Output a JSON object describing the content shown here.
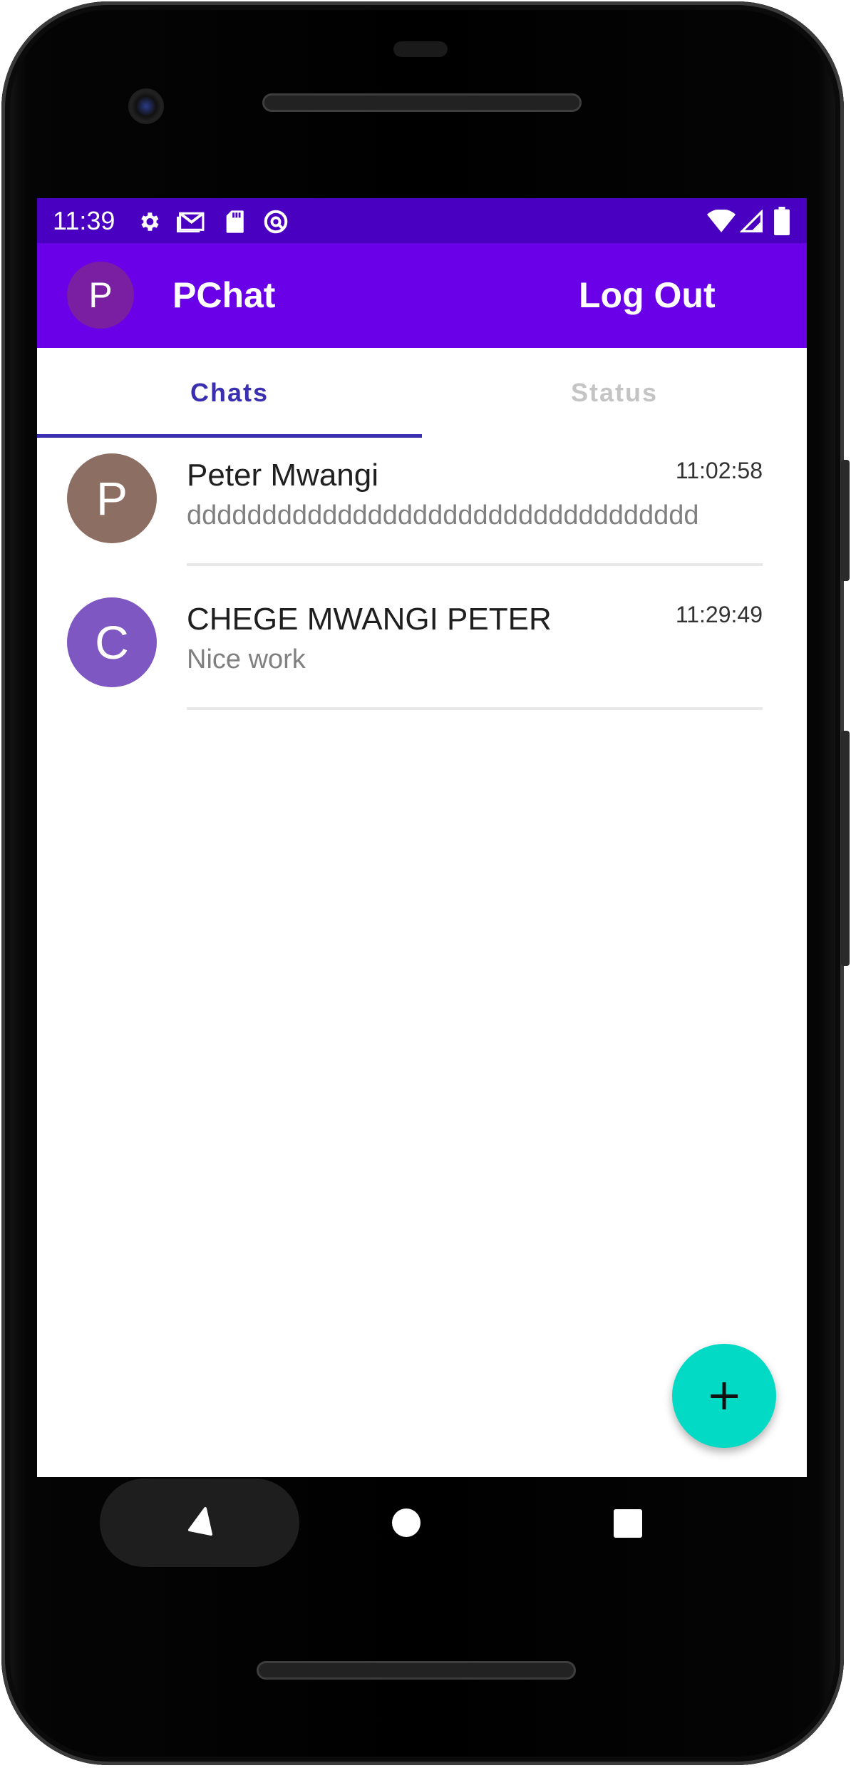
{
  "status_bar": {
    "time": "11:39",
    "left_icons": [
      "gear-icon",
      "gmail-icon",
      "sd-card-icon",
      "vpn-icon"
    ],
    "right_icons": [
      "wifi-icon",
      "signal-icon",
      "battery-icon"
    ],
    "color": "#4a00c0"
  },
  "app_bar": {
    "avatar_letter": "P",
    "title": "PChat",
    "logout_label": "Log Out",
    "color": "#6a00e8"
  },
  "tabs": [
    {
      "label": "Chats",
      "active": true
    },
    {
      "label": "Status",
      "active": false
    }
  ],
  "chats": [
    {
      "avatar_letter": "P",
      "avatar_color": "#8d6e63",
      "name": "Peter Mwangi",
      "time": "11:02:58",
      "message": "dddddddddddddddddddddddddddddddddd"
    },
    {
      "avatar_letter": "C",
      "avatar_color": "#7e57c2",
      "name": "CHEGE MWANGI PETER",
      "time": "11:29:49",
      "message": "Nice work"
    }
  ],
  "fab": {
    "icon": "plus-icon",
    "color": "#03dac5"
  },
  "nav_bar": {
    "buttons": [
      "back-icon",
      "home-icon",
      "recents-icon"
    ]
  }
}
